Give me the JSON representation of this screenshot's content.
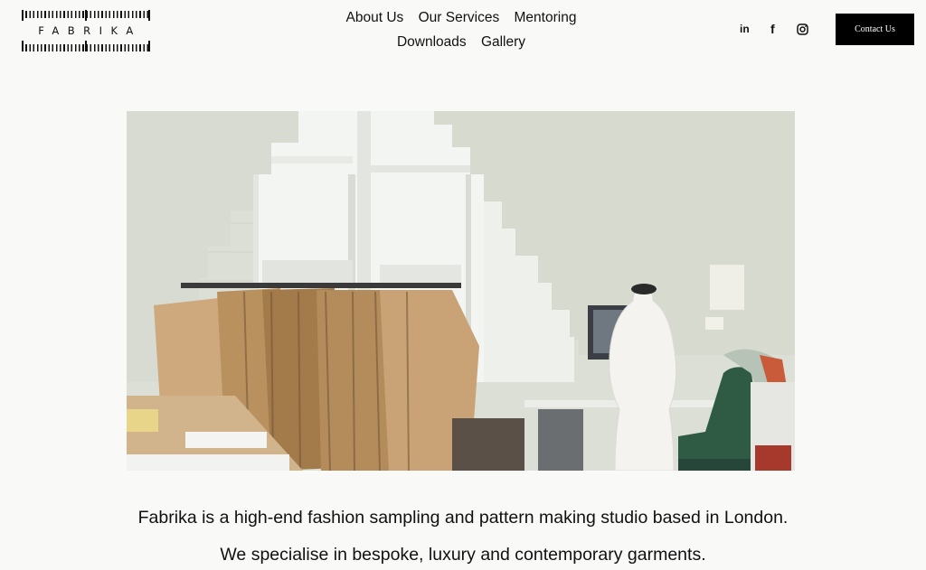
{
  "brand": {
    "name": "FABRIKA"
  },
  "nav": {
    "items": [
      {
        "label": "About Us"
      },
      {
        "label": "Our Services"
      },
      {
        "label": "Mentoring"
      },
      {
        "label": "Downloads"
      },
      {
        "label": "Gallery"
      }
    ]
  },
  "social": {
    "icons": [
      "linkedin-icon",
      "facebook-icon",
      "instagram-icon"
    ],
    "linkedin_text": "in",
    "facebook_text": "f"
  },
  "header": {
    "contact_label": "Contact Us"
  },
  "intro": {
    "line1": "Fabrika is a high-end fashion sampling and pattern making studio based in London.",
    "line2": "We specialise in bespoke, luxury and contemporary garments."
  },
  "colors": {
    "background": "#f9f9f8",
    "text": "#111111",
    "button_bg": "#000000",
    "button_text": "#ffffff"
  }
}
